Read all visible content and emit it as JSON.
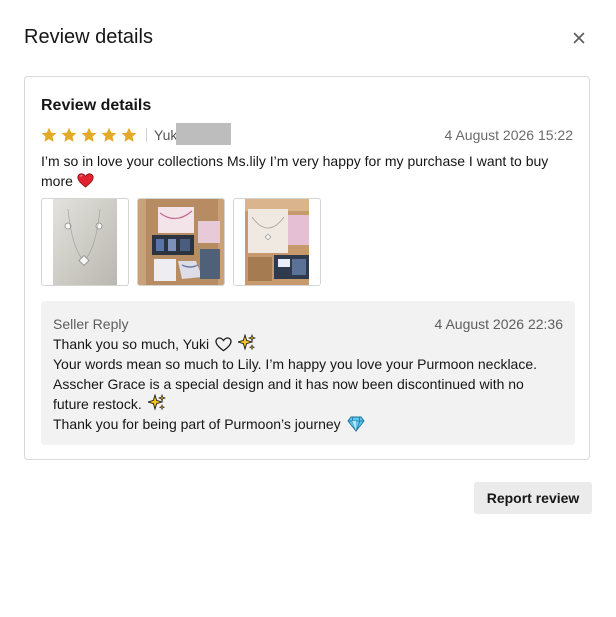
{
  "modal": {
    "title": "Review details",
    "close_icon": "close-icon"
  },
  "review": {
    "card_title": "Review details",
    "rating": 5,
    "max_rating": 5,
    "star_color": "#e3a929",
    "reviewer_name": "Yuk",
    "date": "4 August 2026 15:22",
    "text": "I’m so in love your collections Ms.lily I’m very happy for my purchase I want to buy more",
    "text_emoji": "heart-icon",
    "photos": [
      "necklace-earrings-photo",
      "package-box-photo",
      "necklace-box-photo"
    ]
  },
  "seller_reply": {
    "label": "Seller Reply",
    "date": "4 August 2026 22:36",
    "line1": "Thank you so much, Yuki",
    "line1_icons": [
      "heart-outline-icon",
      "sparkles-icon"
    ],
    "line2": "Your words mean so much to Lily. I’m happy you love your Purmoon necklace.",
    "line3": "Asscher Grace is a special design and it has now been discontinued with no future restock.",
    "line3_icon": "sparkles-icon",
    "line4": "Thank you for being part of Purmoon’s journey",
    "line4_icon": "gem-icon"
  },
  "actions": {
    "report_label": "Report review"
  }
}
